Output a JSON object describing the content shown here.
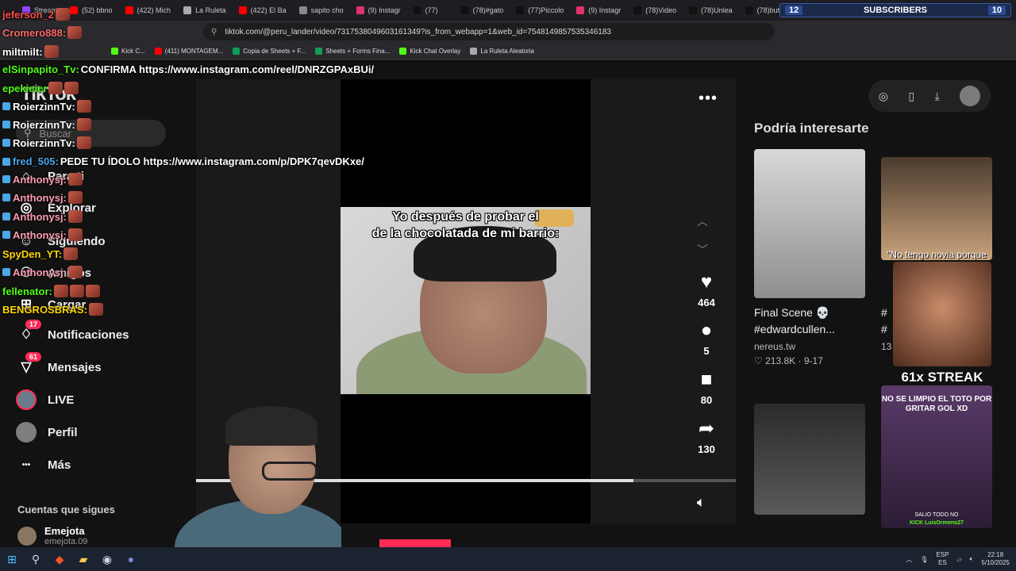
{
  "browser": {
    "tabs": [
      {
        "label": "Stream",
        "color": "#9147ff"
      },
      {
        "label": "(52) bbno",
        "color": "#ff0000"
      },
      {
        "label": "(422) Mich",
        "color": "#ff0000"
      },
      {
        "label": "La Ruleta",
        "color": "#aaaaaa"
      },
      {
        "label": "(422) El Ba",
        "color": "#ff0000"
      },
      {
        "label": "sapito cho",
        "color": "#888888"
      },
      {
        "label": "(9) Instagr",
        "color": "#e1306c"
      },
      {
        "label": "(77)",
        "color": "#111111"
      },
      {
        "label": "(78)#gato",
        "color": "#111111"
      },
      {
        "label": "(77)Piccolo",
        "color": "#111111"
      },
      {
        "label": "(9) Instagr",
        "color": "#e1306c"
      },
      {
        "label": "(78)Video",
        "color": "#111111"
      },
      {
        "label": "(78)Unlea",
        "color": "#111111"
      },
      {
        "label": "(78)butt",
        "color": "#111111"
      }
    ],
    "url": "tiktok.com/@peru_lander/video/7317538049603161349?is_from_webapp=1&web_id=7548149857535346183",
    "bookmarks": [
      {
        "label": "Kick C...",
        "color": "#53fc18"
      },
      {
        "label": "(411) MONTAGEM...",
        "color": "#ff0000"
      },
      {
        "label": "Copia de Sheets + F...",
        "color": "#0f9d58"
      },
      {
        "label": "Sheets + Forms Fina...",
        "color": "#0f9d58"
      },
      {
        "label": "Kick Chat Overlay",
        "color": "#53fc18"
      },
      {
        "label": "La Ruleta Aleatoria",
        "color": "#aaaaaa"
      }
    ]
  },
  "subscribers": {
    "left": "12",
    "label": "SUBSCRIBERS",
    "right": "10"
  },
  "tiktok": {
    "logo": "TikTok",
    "search_placeholder": "Buscar",
    "nav": [
      {
        "label": "Para ti",
        "icon": "home-icon"
      },
      {
        "label": "Explorar",
        "icon": "compass-icon"
      },
      {
        "label": "Siguiendo",
        "icon": "following-icon"
      },
      {
        "label": "Amigos",
        "icon": "friends-icon"
      },
      {
        "label": "Cargar",
        "icon": "upload-icon"
      },
      {
        "label": "Notificaciones",
        "icon": "bell-icon",
        "badge": "17"
      },
      {
        "label": "Mensajes",
        "icon": "message-icon",
        "badge": "61"
      },
      {
        "label": "LIVE",
        "icon": "live-icon"
      },
      {
        "label": "Perfil",
        "icon": "profile-icon"
      },
      {
        "label": "Más",
        "icon": "more-icon"
      }
    ],
    "following_title": "Cuentas que sigues",
    "following_user": {
      "name": "Emejota",
      "handle": "emejota.09"
    },
    "video": {
      "caption_line1": "Yo después de probar el",
      "caption_line2": "de la chocolatada de mi barrio:",
      "likes": "464",
      "comments": "5",
      "saves": "80",
      "shares": "130",
      "progress": 0.81
    },
    "recommend_title": "Podría interesarte",
    "recommendations": [
      {
        "title": "Final Scene 💀",
        "tag": "#edwardcullen...",
        "author": "nereus.tw",
        "likes": "213.8K",
        "date": "9-17"
      },
      {
        "title": "#",
        "tag": "#",
        "author": "13",
        "likes": "",
        "date": ""
      }
    ],
    "rec_thumb_text": "\"No tengo novia porque me enfoco"
  },
  "chat": [
    {
      "user": "jeferson_2",
      "text": "",
      "color": "#ff4d4d",
      "emotes": 1
    },
    {
      "user": "Cromero888:",
      "text": "",
      "color": "#ff6b6b",
      "emotes": 1
    },
    {
      "user": "miltmilt:",
      "text": "",
      "color": "#ffffff",
      "emotes": 1
    },
    {
      "user": "elSinpapito_Tv:",
      "text": " CONFIRMA https://www.instagram.com/reel/DNRZGPAxBUi/",
      "color": "#53fc18",
      "emotes": 0
    },
    {
      "user": "epekieier",
      "text": "",
      "color": "#53fc18",
      "emotes": 2
    },
    {
      "user": "RoierzinnTv:",
      "text": "",
      "color": "#ffffff",
      "emotes": 1
    },
    {
      "user": "RoierzinnTv:",
      "text": "",
      "color": "#ffffff",
      "emotes": 1
    },
    {
      "user": "RoierzinnTv:",
      "text": "",
      "color": "#ffffff",
      "emotes": 1
    },
    {
      "user": "fred_505:",
      "text": " PEDE TU ÍDOLO https://www.instagram.com/p/DPK7qevDKxe/",
      "color": "#4aa7e8",
      "emotes": 0
    },
    {
      "user": "Anthonysj:",
      "text": "",
      "color": "#ff9eb5",
      "emotes": 1
    },
    {
      "user": "Anthonysj:",
      "text": "",
      "color": "#ff9eb5",
      "emotes": 1
    },
    {
      "user": "Anthonysj:",
      "text": "",
      "color": "#ff9eb5",
      "emotes": 1
    },
    {
      "user": "Anthonysj:",
      "text": "",
      "color": "#ff9eb5",
      "emotes": 1
    },
    {
      "user": "SpyDen_YT:",
      "text": "",
      "color": "#ffd700",
      "emotes": 1
    },
    {
      "user": "Anthonysj:",
      "text": "",
      "color": "#ff9eb5",
      "emotes": 1
    },
    {
      "user": "fellenator:",
      "text": "",
      "color": "#53fc18",
      "emotes": 3
    },
    {
      "user": "BENGROSBRAS:",
      "text": "",
      "color": "#ffd700",
      "emotes": 1
    }
  ],
  "overlay": {
    "streak": "61x STREAK",
    "kick_top": "NO SE LIMPIO EL TOTO POR GRITAR GOL XD",
    "kick_bottom": "SALIO TODO NO",
    "kick_handle": "LuisOrmeno27",
    "kick_brand": "KICK"
  },
  "taskbar": {
    "lang1": "ESP",
    "lang2": "ES",
    "time": "22:18",
    "date": "5/10/2025"
  }
}
